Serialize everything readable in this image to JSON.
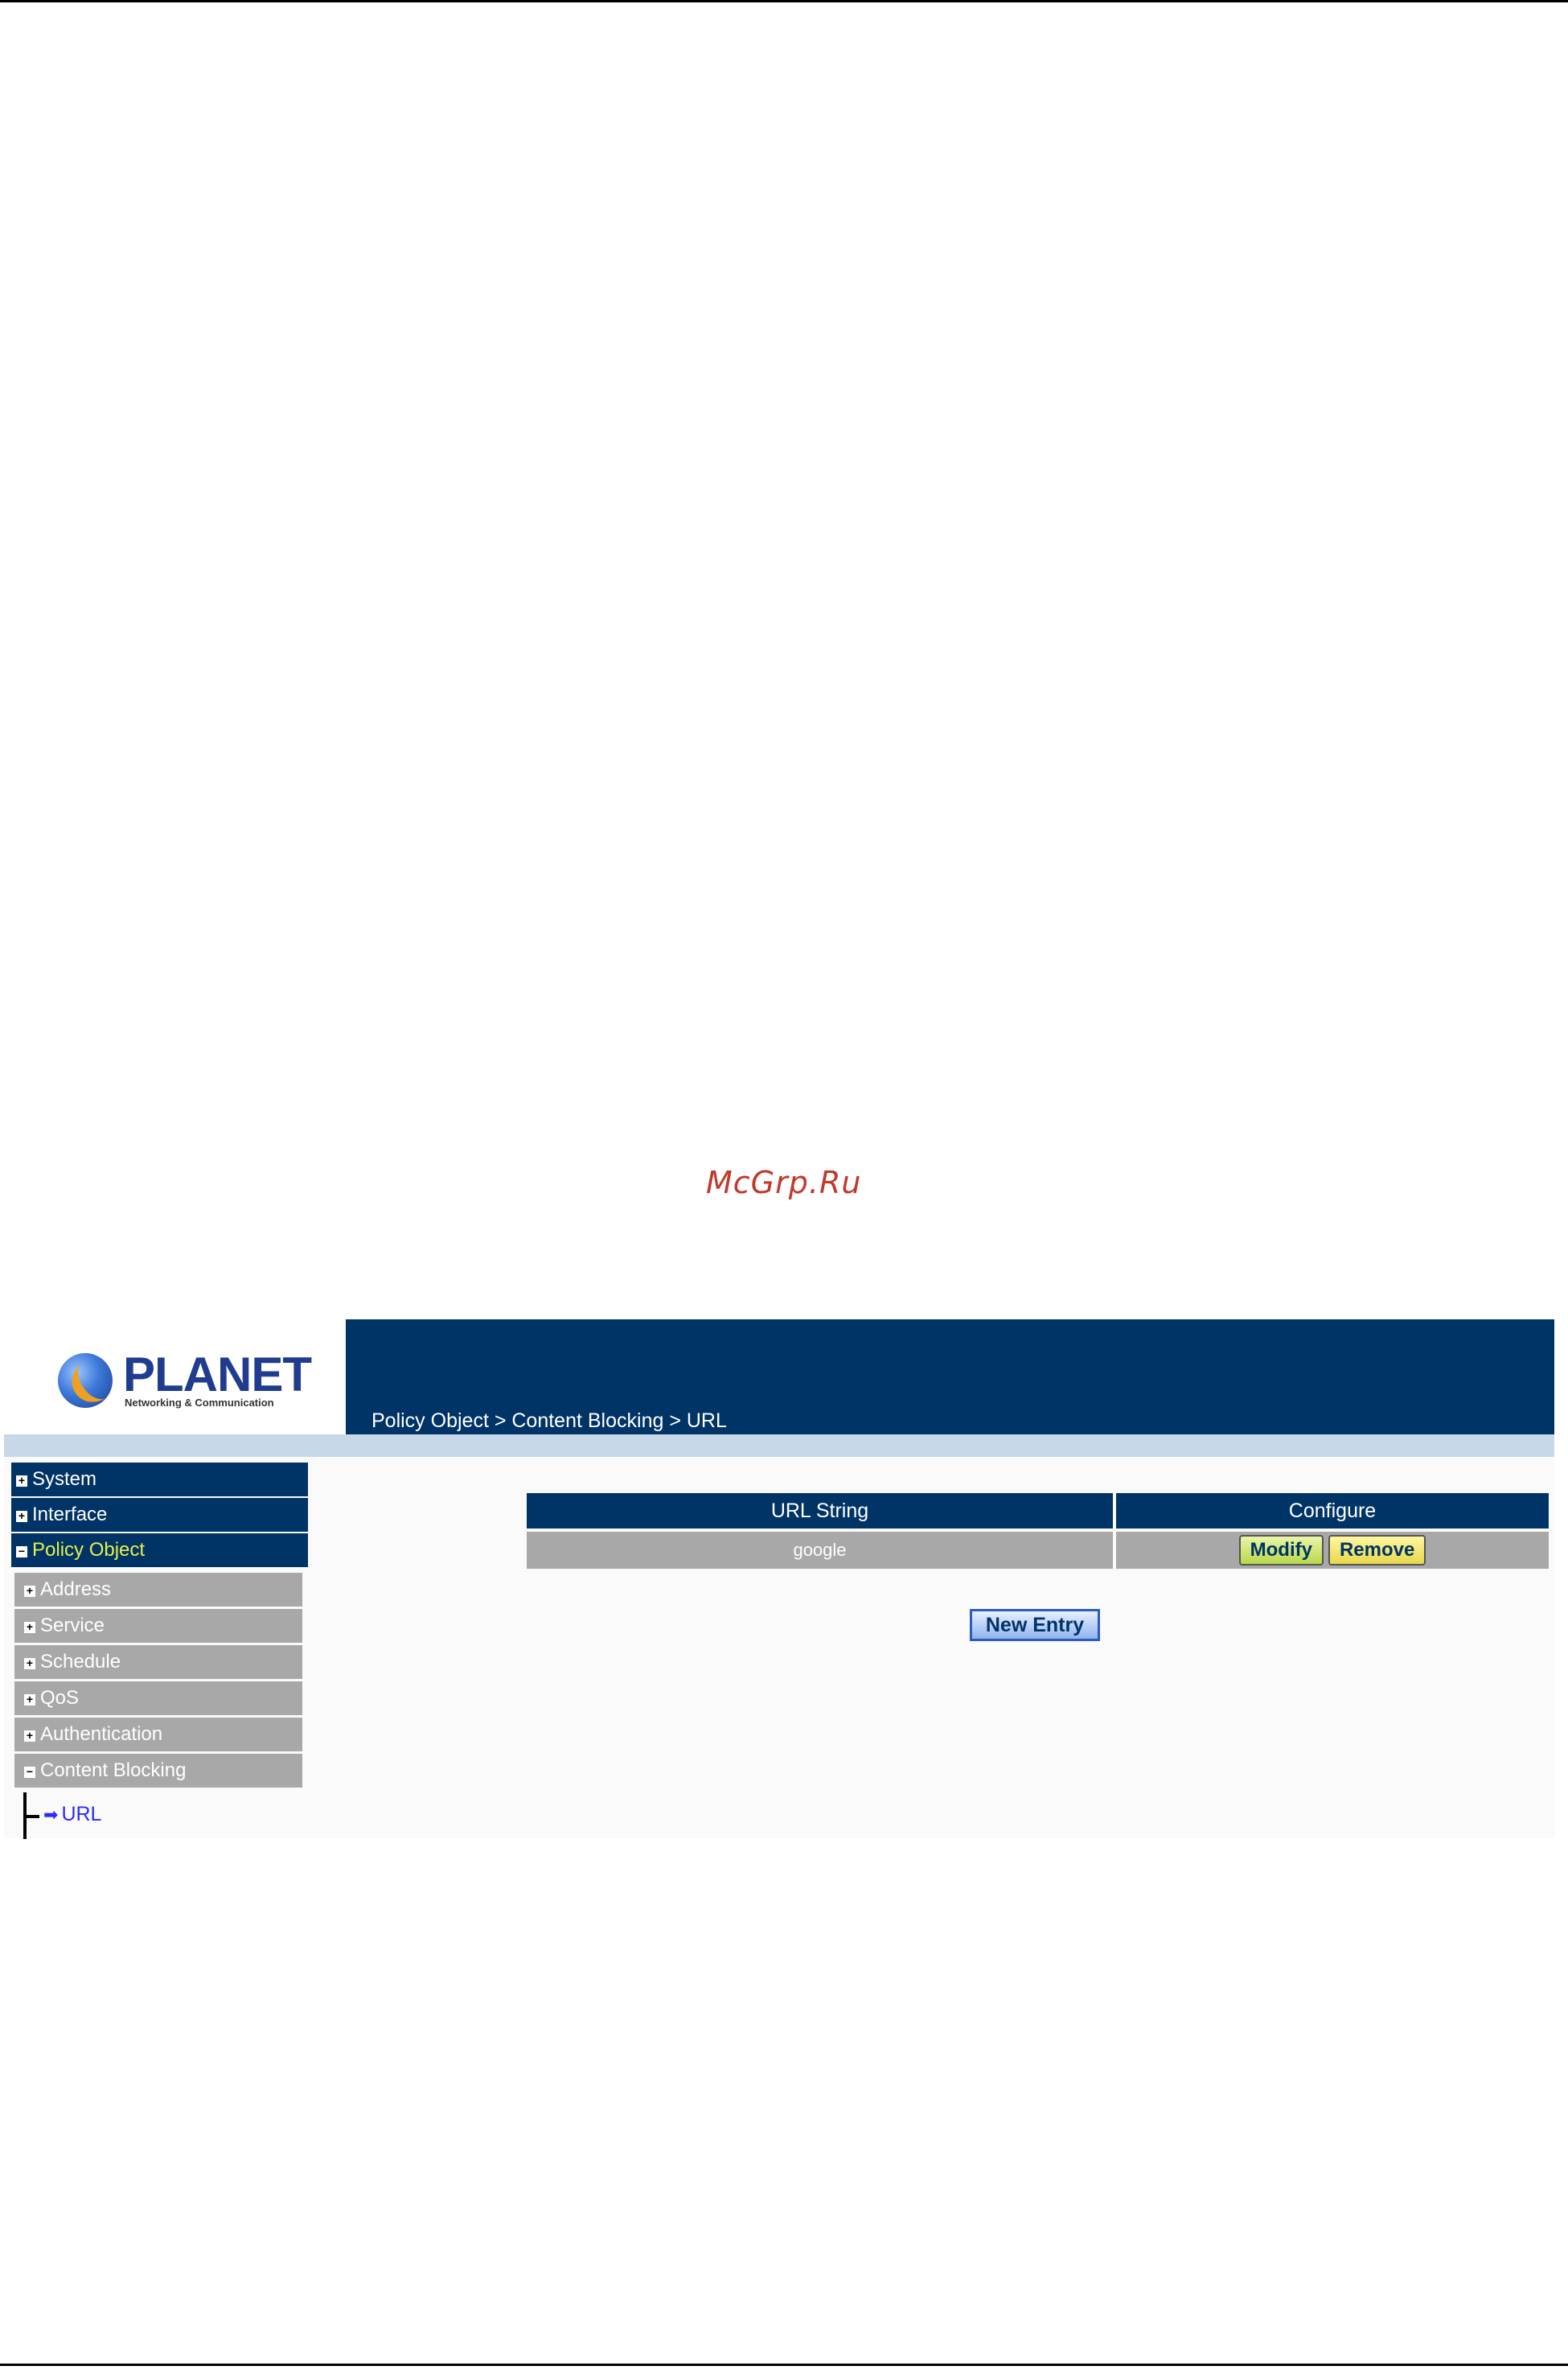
{
  "watermark": "McGrp.Ru",
  "logo": {
    "name": "PLANET",
    "tagline": "Networking & Communication"
  },
  "header": {
    "breadcrumb": "Policy Object > Content Blocking > URL"
  },
  "sidebar": {
    "main_items": [
      {
        "label": "System",
        "expanded": false
      },
      {
        "label": "Interface",
        "expanded": false
      },
      {
        "label": "Policy Object",
        "expanded": true
      }
    ],
    "sub_items": [
      {
        "label": "Address"
      },
      {
        "label": "Service"
      },
      {
        "label": "Schedule"
      },
      {
        "label": "QoS"
      },
      {
        "label": "Authentication"
      },
      {
        "label": "Content Blocking"
      }
    ],
    "active_leaf": "URL"
  },
  "table": {
    "headers": [
      "URL String",
      "Configure"
    ],
    "rows": [
      {
        "url_string": "google"
      }
    ],
    "modify_label": "Modify",
    "remove_label": "Remove"
  },
  "new_entry_label": "New Entry",
  "colors": {
    "header_bg": "#003366",
    "row_bg": "#a8a8a8",
    "active_text": "#e6f04a",
    "link": "#2b2bff"
  }
}
